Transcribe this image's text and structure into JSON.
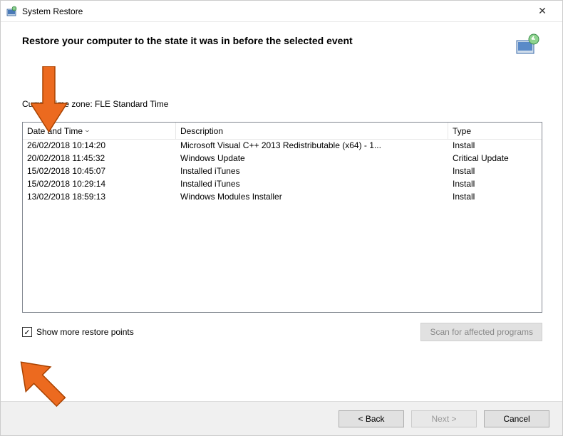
{
  "window": {
    "title": "System Restore"
  },
  "header": {
    "text": "Restore your computer to the state it was in before the selected event"
  },
  "timezone_text": "Current time zone: FLE Standard Time",
  "table": {
    "columns": {
      "date": "Date and Time",
      "desc": "Description",
      "type": "Type"
    },
    "rows": [
      {
        "date": "26/02/2018 10:14:20",
        "desc": "Microsoft Visual C++ 2013 Redistributable (x64) - 1...",
        "type": "Install"
      },
      {
        "date": "20/02/2018 11:45:32",
        "desc": "Windows Update",
        "type": "Critical Update"
      },
      {
        "date": "15/02/2018 10:45:07",
        "desc": "Installed iTunes",
        "type": "Install"
      },
      {
        "date": "15/02/2018 10:29:14",
        "desc": "Installed iTunes",
        "type": "Install"
      },
      {
        "date": "13/02/2018 18:59:13",
        "desc": "Windows Modules Installer",
        "type": "Install"
      }
    ]
  },
  "checkbox": {
    "label": "Show more restore points",
    "checked": true
  },
  "buttons": {
    "scan": "Scan for affected programs",
    "back": "< Back",
    "next": "Next >",
    "cancel": "Cancel"
  }
}
